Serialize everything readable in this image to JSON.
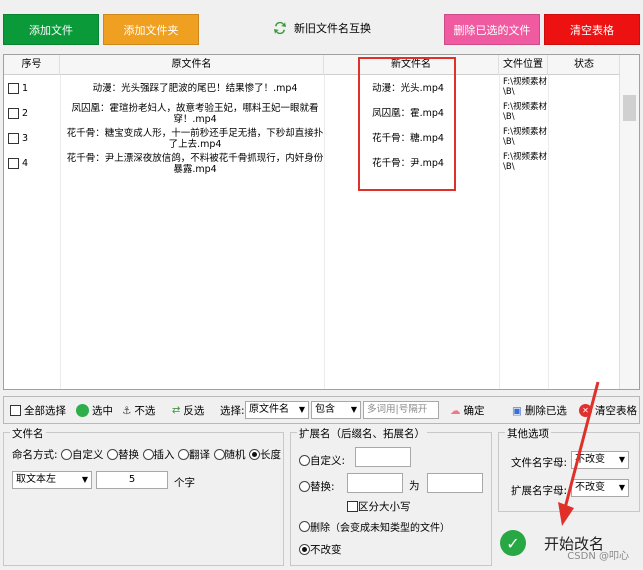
{
  "toolbar": {
    "add_file": "添加文件",
    "add_folder": "添加文件夹",
    "swap_names": "新旧文件名互换",
    "delete_selected": "删除已选的文件",
    "clear_table": "清空表格"
  },
  "table": {
    "headers": {
      "seq": "序号",
      "original": "原文件名",
      "new_name": "新文件名",
      "location": "文件位置",
      "status": "状态"
    },
    "rows": [
      {
        "seq": "1",
        "original": "动漫：光头强踩了肥波的尾巴！结果惨了！.mp4",
        "new_name": "动漫：光头.mp4",
        "location": "F:\\视频素材\\B\\",
        "status": ""
      },
      {
        "seq": "2",
        "original": "凤囚凰：霍瑄扮老妇人，故意考验王妃，哪料王妃一眼就看穿！.mp4",
        "new_name": "凤囚凰：霍.mp4",
        "location": "F:\\视频素材\\B\\",
        "status": ""
      },
      {
        "seq": "3",
        "original": "花千骨：糖宝变成人形，十一前秒还手足无措，下秒却直接扑了上去.mp4",
        "new_name": "花千骨：糖.mp4",
        "location": "F:\\视频素材\\B\\",
        "status": ""
      },
      {
        "seq": "4",
        "original": "花千骨：尹上漂深夜放信鸽，不料被花千骨抓现行，内奸身份暴露.mp4",
        "new_name": "花千骨：尹.mp4",
        "location": "F:\\视频素材\\B\\",
        "status": ""
      }
    ]
  },
  "selection": {
    "select_all": "全部选择",
    "select": "选中",
    "deselect": "不选",
    "invert": "反选",
    "choose_label": "选择:",
    "field_value": "原文件名",
    "match_value": "包含",
    "keyword_placeholder": "多词用|号隔开",
    "confirm": "确定",
    "delete_selected": "删除已选",
    "clear_table": "清空表格"
  },
  "filename_panel": {
    "title": "文件名",
    "mode_label": "命名方式:",
    "modes": [
      "自定义",
      "替换",
      "插入",
      "翻译",
      "随机",
      "长度"
    ],
    "selected_mode": "长度",
    "take_from": "取文本左",
    "count": "5",
    "unit": "个字"
  },
  "ext_panel": {
    "title": "扩展名（后缀名、拓展名）",
    "custom": "自定义:",
    "replace": "替换:",
    "to": "为",
    "case_sensitive": "区分大小写",
    "delete": "删除（会变成未知类型的文件）",
    "unchanged": "不改变"
  },
  "other_panel": {
    "title": "其他选项",
    "filename_case_label": "文件名字母:",
    "filename_case_value": "不改变",
    "ext_case_label": "扩展名字母:",
    "ext_case_value": "不改变"
  },
  "start": {
    "label": "开始改名"
  },
  "watermark": "CSDN @叩心",
  "colors": {
    "add_file": "#0a9a3a",
    "add_folder": "#f0a020",
    "delete_selected": "#f05aa0",
    "clear_table": "#ee1111",
    "highlight_box": "#e0302a",
    "start_icon": "#28a745"
  }
}
